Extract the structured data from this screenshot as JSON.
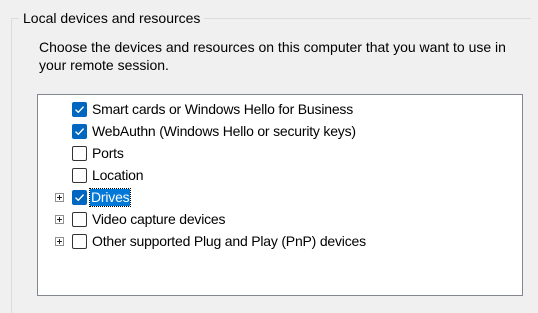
{
  "group": {
    "title": "Local devices and resources"
  },
  "description": "Choose the devices and resources on this computer that you want to use in your remote session.",
  "tree": {
    "items": [
      {
        "label": "Smart cards or Windows Hello for Business",
        "checked": true,
        "expandable": false,
        "selected": false
      },
      {
        "label": "WebAuthn (Windows Hello or security keys)",
        "checked": true,
        "expandable": false,
        "selected": false
      },
      {
        "label": "Ports",
        "checked": false,
        "expandable": false,
        "selected": false
      },
      {
        "label": "Location",
        "checked": false,
        "expandable": false,
        "selected": false
      },
      {
        "label": "Drives",
        "checked": true,
        "expandable": true,
        "selected": true
      },
      {
        "label": "Video capture devices",
        "checked": false,
        "expandable": true,
        "selected": false
      },
      {
        "label": "Other supported Plug and Play (PnP) devices",
        "checked": false,
        "expandable": true,
        "selected": false
      }
    ]
  },
  "colors": {
    "accent": "#0067c0",
    "selection": "#0078d7",
    "background": "#f0f0f0"
  }
}
